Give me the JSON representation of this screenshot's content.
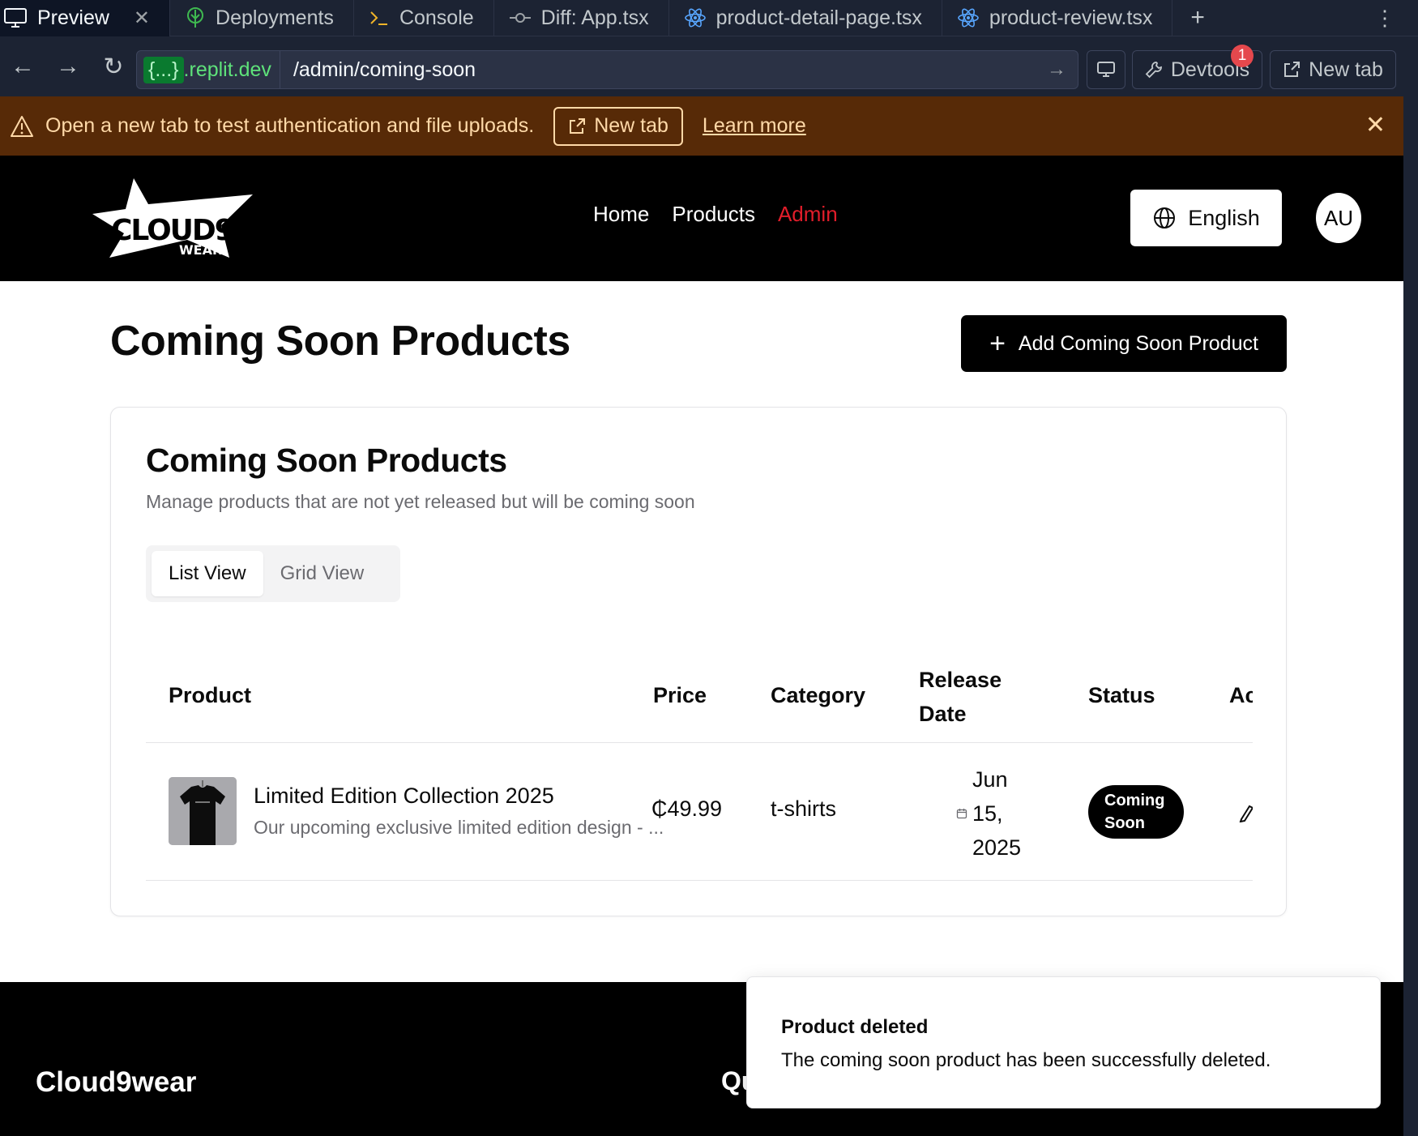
{
  "workspace": {
    "tabs": [
      {
        "label": "Preview",
        "icon": "monitor-icon",
        "active": true
      },
      {
        "label": "Deployments",
        "icon": "deployments-icon"
      },
      {
        "label": "Console",
        "icon": "terminal-icon"
      },
      {
        "label": "Diff: App.tsx",
        "icon": "git-commit-icon"
      },
      {
        "label": "product-detail-page.tsx",
        "icon": "react-icon"
      },
      {
        "label": "product-review.tsx",
        "icon": "react-icon"
      }
    ],
    "url": {
      "brace": "{...}",
      "domain": ".replit.dev",
      "path": "/admin/coming-soon"
    },
    "devtools_label": "Devtools",
    "devtools_badge": "1",
    "new_tab_label": "New tab"
  },
  "banner": {
    "message": "Open a new tab to test authentication and file uploads.",
    "button_label": "New tab",
    "link_label": "Learn more",
    "color": "#572a07"
  },
  "header": {
    "logo_text": "CLOUD9.",
    "logo_subtext": "WEAR",
    "nav": [
      {
        "label": "Home"
      },
      {
        "label": "Products"
      },
      {
        "label": "Admin",
        "active": true,
        "color": "#e11d2a"
      }
    ],
    "language": "English",
    "avatar_initials": "AU"
  },
  "main": {
    "title": "Coming Soon Products",
    "add_button_label": "Add Coming Soon Product",
    "card": {
      "title": "Coming Soon Products",
      "subtitle": "Manage products that are not yet released but will be coming soon",
      "tabs": [
        {
          "label": "List View",
          "selected": true
        },
        {
          "label": "Grid View"
        }
      ],
      "table": {
        "columns": [
          "Product",
          "Price",
          "Category",
          "Release Date",
          "Status",
          "Ac"
        ],
        "rows": [
          {
            "name": "Limited Edition Collection 2025",
            "description": "Our upcoming exclusive limited edition design - ...",
            "price": "₵49.99",
            "category": "t-shirts",
            "release_date": "Jun 15, 2025",
            "status": "Coming Soon"
          }
        ]
      }
    }
  },
  "footer": {
    "brand": "Cloud9wear",
    "column_partial": "Qu"
  },
  "toast": {
    "title": "Product deleted",
    "description": "The coming soon product has been successfully deleted."
  }
}
